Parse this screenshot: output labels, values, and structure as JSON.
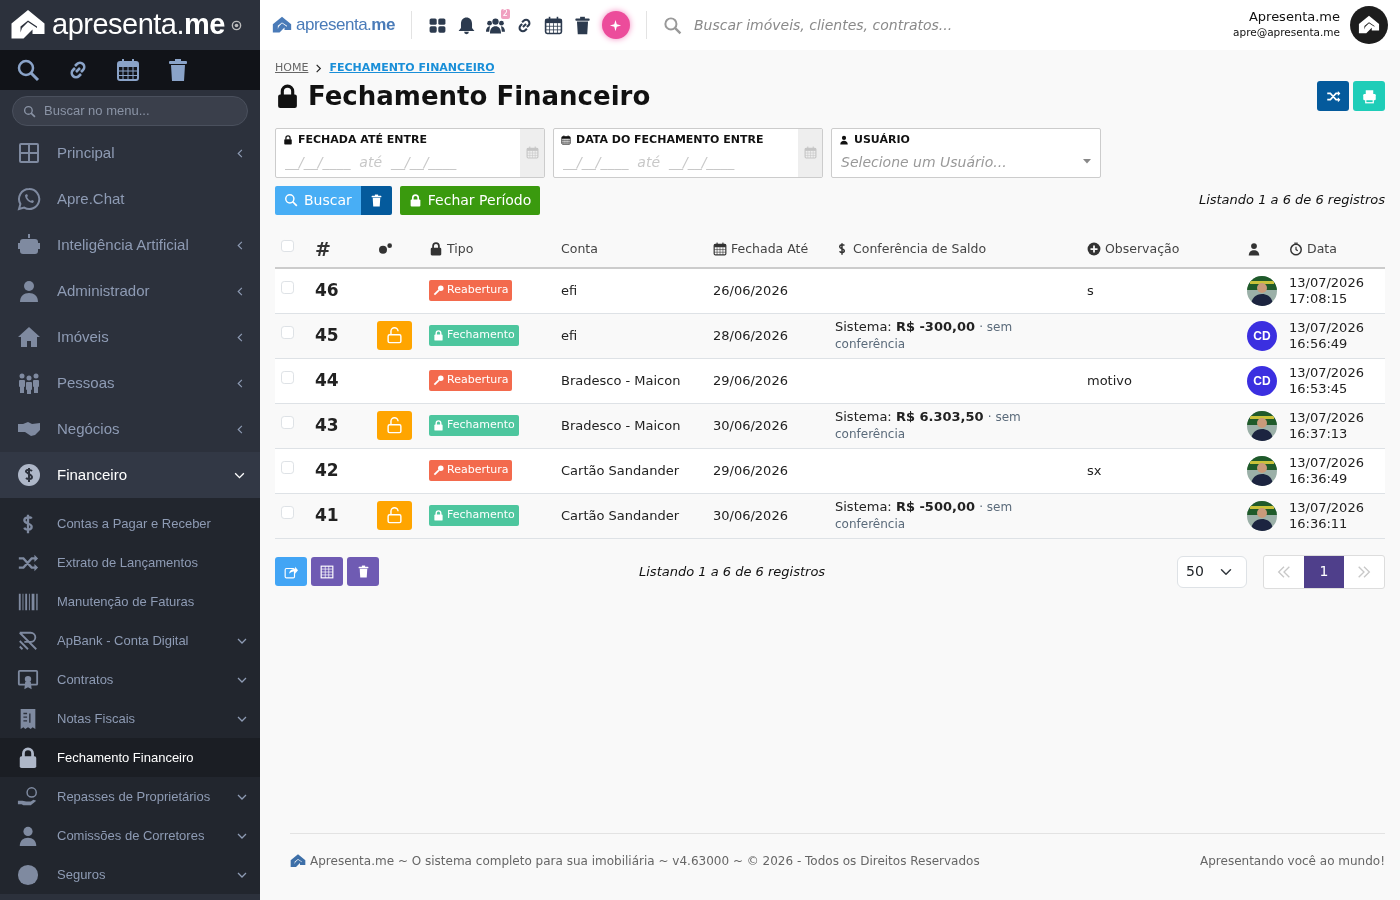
{
  "sidebar": {
    "brand": "apresenta.**me**",
    "search": {
      "placeholder": "Buscar no menu..."
    },
    "items": [
      {
        "label": "Principal",
        "expanded": false,
        "selected": false
      },
      {
        "label": "Apre.Chat",
        "selected": false
      },
      {
        "label": "Inteligência Artificial",
        "expanded": false,
        "selected": false
      },
      {
        "label": "Administrador",
        "expanded": false,
        "selected": false
      },
      {
        "label": "Imóveis",
        "expanded": false,
        "selected": false
      },
      {
        "label": "Pessoas",
        "expanded": false,
        "selected": false
      },
      {
        "label": "Negócios",
        "expanded": false,
        "selected": false
      },
      {
        "label": "Financeiro",
        "expanded": true,
        "selected": false,
        "children": [
          {
            "label": "Contas a Pagar e Receber",
            "selected": false
          },
          {
            "label": "Extrato de Lançamentos",
            "selected": false
          },
          {
            "label": "Manutenção de Faturas",
            "selected": false
          },
          {
            "label": "ApBank - Conta Digital",
            "expanded": false,
            "selected": false
          },
          {
            "label": "Contratos",
            "expanded": false,
            "selected": false
          },
          {
            "label": "Notas Fiscais",
            "expanded": false,
            "selected": false
          },
          {
            "label": "Fechamento Financeiro",
            "selected": true
          },
          {
            "label": "Repasses de Proprietários",
            "expanded": false,
            "selected": false
          },
          {
            "label": "Comissões de Corretores",
            "expanded": false,
            "selected": false
          },
          {
            "label": "Seguros",
            "expanded": false,
            "selected": false
          }
        ]
      }
    ]
  },
  "topbar": {
    "brand": "apresenta.**me**",
    "notification_count": "2",
    "search": {
      "placeholder": "Buscar imóveis, clientes, contratos..."
    },
    "user": {
      "name": "Apresenta.me",
      "email": "apre@apresenta.me"
    }
  },
  "breadcrumb": [
    {
      "label": "HOME",
      "selected": false
    },
    {
      "label": "FECHAMENTO FINANCEIRO",
      "selected": true
    }
  ],
  "title": "Fechamento Financeiro",
  "filters": [
    {
      "kind": "date_range",
      "label": "FECHADA ATÉ ENTRE",
      "placeholder": "__/__/____  até  __/__/____"
    },
    {
      "kind": "date_range",
      "label": "DATA DO FECHAMENTO ENTRE",
      "placeholder": "__/__/____  até  __/__/____"
    },
    {
      "kind": "select",
      "label": "USUÁRIO",
      "placeholder": "Selecione um Usuário..."
    }
  ],
  "actions": {
    "search": "Buscar",
    "close_period": "Fechar Período"
  },
  "listing_top": "Listando 1 a 6 de 6 registros",
  "table": {
    "columns": [
      {
        "kind": "select",
        "checked": false
      },
      {
        "kind": "id",
        "label": "#"
      },
      {
        "kind": "actions"
      },
      {
        "kind": "type",
        "label": "Tipo"
      },
      {
        "kind": "account",
        "label": "Conta"
      },
      {
        "kind": "closed_until",
        "label": "Fechada Até"
      },
      {
        "kind": "balance",
        "label": "Conferência de Saldo"
      },
      {
        "kind": "note",
        "label": "Observação"
      },
      {
        "kind": "user"
      },
      {
        "kind": "date",
        "label": "Data"
      }
    ],
    "rows": [
      {
        "checked": false,
        "id": "46",
        "unlock_button": false,
        "type": {
          "kind": "reopening",
          "label": "Reabertura"
        },
        "account": "efi",
        "closed_until": "26/06/2026",
        "note": "s",
        "date": "13/07/2026",
        "time": "17:08:15"
      },
      {
        "checked": false,
        "id": "45",
        "unlock_button": true,
        "type": {
          "kind": "closing",
          "label": "Fechamento"
        },
        "account": "efi",
        "closed_until": "28/06/2026",
        "balance": {
          "system": "Sistema: **R$ -300,00**",
          "note": "· sem conferência"
        },
        "user": {
          "kind": "initials",
          "initials": "CD"
        },
        "date": "13/07/2026",
        "time": "16:56:49"
      },
      {
        "checked": false,
        "id": "44",
        "unlock_button": false,
        "type": {
          "kind": "reopening",
          "label": "Reabertura"
        },
        "account": "Bradesco - Maicon",
        "closed_until": "29/06/2026",
        "note": "motivo",
        "user": {
          "kind": "initials",
          "initials": "CD"
        },
        "date": "13/07/2026",
        "time": "16:53:45"
      },
      {
        "checked": false,
        "id": "43",
        "unlock_button": true,
        "type": {
          "kind": "closing",
          "label": "Fechamento"
        },
        "account": "Bradesco - Maicon",
        "closed_until": "30/06/2026",
        "balance": {
          "system": "Sistema: **R$ 6.303,50**",
          "note": "· sem conferência"
        },
        "date": "13/07/2026",
        "time": "16:37:13"
      },
      {
        "checked": false,
        "id": "42",
        "unlock_button": false,
        "type": {
          "kind": "reopening",
          "label": "Reabertura"
        },
        "account": "Cartão Sandander",
        "closed_until": "29/06/2026",
        "note": "sx",
        "date": "13/07/2026",
        "time": "16:36:49"
      },
      {
        "checked": false,
        "id": "41",
        "unlock_button": true,
        "type": {
          "kind": "closing",
          "label": "Fechamento"
        },
        "account": "Cartão Sandander",
        "closed_until": "30/06/2026",
        "balance": {
          "system": "Sistema: **R$ -500,00**",
          "note": "· sem conferência"
        },
        "date": "13/07/2026",
        "time": "16:36:11"
      }
    ]
  },
  "pagination": {
    "page_size": "50",
    "listing": "Listando 1 a 6 de 6 registros",
    "previous_disabled": true,
    "next_disabled": true,
    "pages": [
      {
        "label": "1",
        "selected": true
      }
    ]
  },
  "footer": {
    "left": "Apresenta.me ~ O sistema completo para sua imobiliária ~ v4.63000 ~ © 2026 - Todos os Direitos Reservados",
    "right": "Apresentando você ao mundo!"
  }
}
